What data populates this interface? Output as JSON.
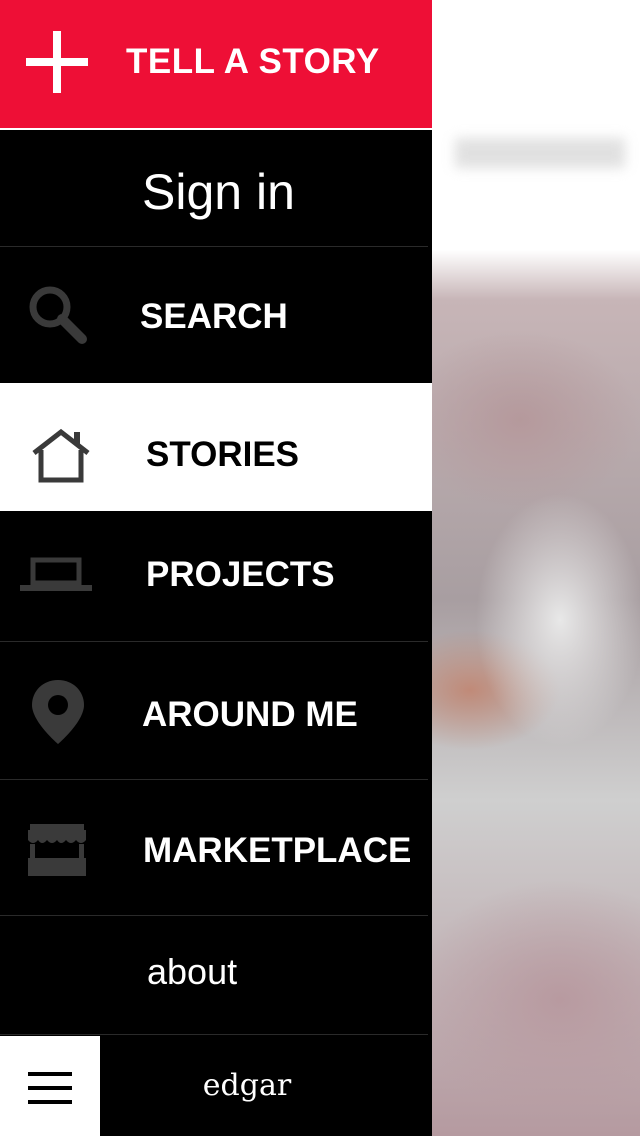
{
  "actions": {
    "tell_story_label": "TELL A STORY",
    "tell_story_icon": "plus-icon"
  },
  "auth": {
    "sign_in_label": "Sign in"
  },
  "nav": {
    "items": [
      {
        "label": "SEARCH",
        "icon": "search-icon",
        "selected": false
      },
      {
        "label": "STORIES",
        "icon": "home-icon",
        "selected": true
      },
      {
        "label": "PROJECTS",
        "icon": "laptop-icon",
        "selected": false
      },
      {
        "label": "AROUND ME",
        "icon": "map-pin-icon",
        "selected": false
      },
      {
        "label": "MARKETPLACE",
        "icon": "market-stall-icon",
        "selected": false
      }
    ],
    "about_label": "about"
  },
  "footer": {
    "logo_text": "edgar",
    "menu_icon": "hamburger-menu-icon"
  },
  "colors": {
    "accent": "#ee0f36",
    "drawer_bg": "#000000",
    "selected_bg": "#ffffff",
    "icon_gray": "#3a3a3a"
  }
}
